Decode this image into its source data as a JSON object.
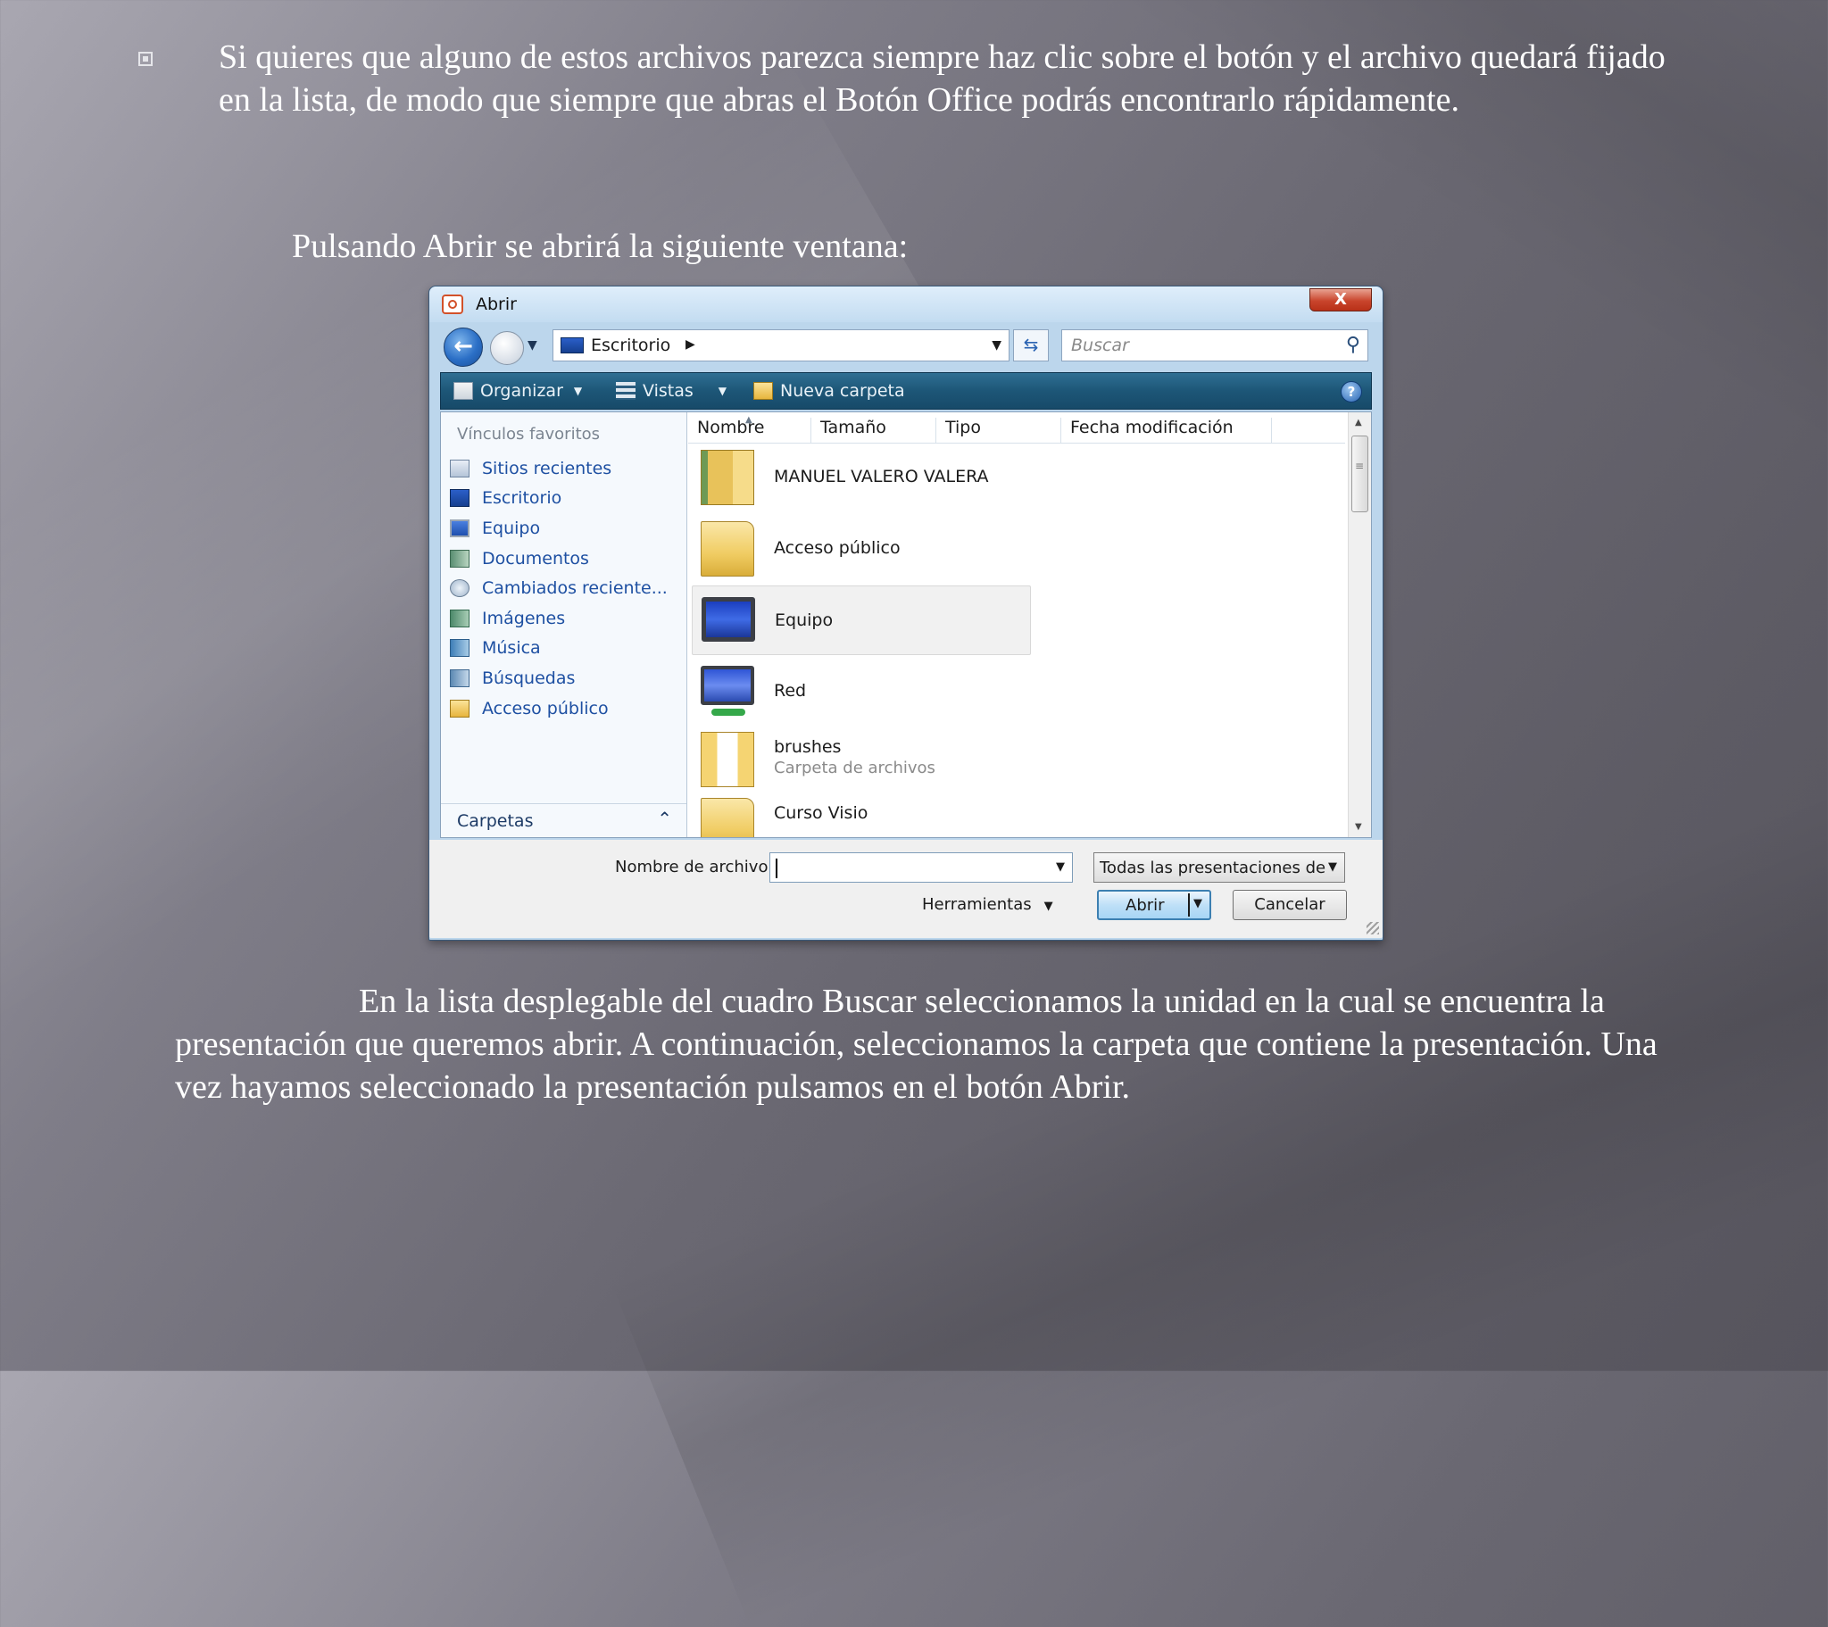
{
  "slide": {
    "paragraph1": "Si quieres que alguno de estos archivos parezca siempre haz clic sobre el botón y el archivo quedará fijado en la lista, de modo que siempre que abras el Botón Office podrás encontrarlo rápidamente.",
    "paragraph2": "Pulsando Abrir se abrirá la siguiente ventana:",
    "paragraph3": "En la lista desplegable del cuadro Buscar seleccionamos la unidad en la cual se encuentra la presentación que queremos abrir. A continuación, seleccionamos la carpeta que contiene la presentación. Una vez hayamos seleccionado la presentación pulsamos en el botón Abrir."
  },
  "dialog": {
    "title": "Abrir",
    "close_glyph": "X",
    "address": "Escritorio",
    "search_placeholder": "Buscar",
    "toolbar": {
      "organize": "Organizar",
      "views": "Vistas",
      "new_folder": "Nueva carpeta",
      "help": "?"
    },
    "favorites_title": "Vínculos favoritos",
    "favorites": [
      {
        "label": "Sitios recientes",
        "icon": "recent-places-icon"
      },
      {
        "label": "Escritorio",
        "icon": "desktop-icon"
      },
      {
        "label": "Equipo",
        "icon": "computer-icon"
      },
      {
        "label": "Documentos",
        "icon": "documents-icon"
      },
      {
        "label": "Cambiados reciente...",
        "icon": "recently-changed-icon"
      },
      {
        "label": "Imágenes",
        "icon": "pictures-icon"
      },
      {
        "label": "Música",
        "icon": "music-icon"
      },
      {
        "label": "Búsquedas",
        "icon": "searches-icon"
      },
      {
        "label": "Acceso público",
        "icon": "public-icon"
      }
    ],
    "folders_label": "Carpetas",
    "columns": [
      "Nombre",
      "Tamaño",
      "Tipo",
      "Fecha modificación"
    ],
    "files": [
      {
        "name": "MANUEL VALERO VALERA",
        "sub": "",
        "icon": "user-folder-icon"
      },
      {
        "name": "Acceso público",
        "sub": "",
        "icon": "folder-icon"
      },
      {
        "name": "Equipo",
        "sub": "",
        "icon": "computer-icon",
        "selected": true
      },
      {
        "name": "Red",
        "sub": "",
        "icon": "network-icon"
      },
      {
        "name": "brushes",
        "sub": "Carpeta de archivos",
        "icon": "folder-icon"
      },
      {
        "name": "Curso Visio",
        "sub": "",
        "icon": "folder-icon"
      }
    ],
    "filename_label": "Nombre de archivo:",
    "filename_value": "",
    "filetype": "Todas las presentaciones de",
    "tools_label": "Herramientas",
    "open_label": "Abrir",
    "cancel_label": "Cancelar"
  }
}
